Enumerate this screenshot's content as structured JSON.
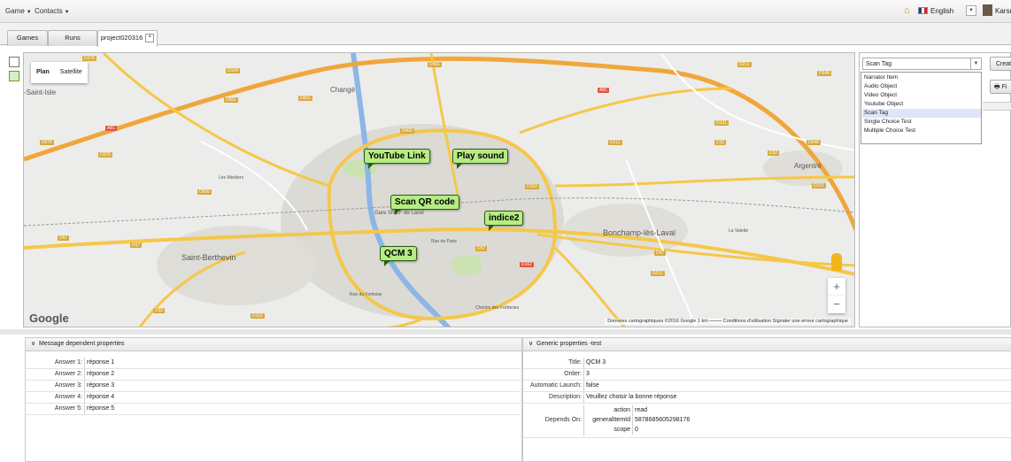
{
  "menubar": {
    "game": "Game",
    "contacts": "Contacts",
    "language": "English",
    "user": "Karsui A"
  },
  "tabs": [
    {
      "label": "Games"
    },
    {
      "label": "Runs"
    },
    {
      "label": "project020316"
    }
  ],
  "map": {
    "type_plan": "Plan",
    "type_satellite": "Satellite",
    "markers": [
      "YouTube Link",
      "Play sound",
      "Scan QR code",
      "indice2",
      "QCM 3"
    ],
    "towns": [
      "Saint-Berthevin",
      "Bonchamp-lès-Laval",
      "Argentré",
      "Changé",
      "Gare SNCF de Laval",
      "-Saint-Isle",
      "Les Mesliers",
      "La Valette",
      "Rue du Fontvise",
      "Rue de Paris",
      "Chemin des Fréheries"
    ],
    "roads": [
      "D278",
      "D104",
      "D561",
      "D561",
      "D561",
      "D900",
      "D57",
      "D57",
      "D57",
      "D162",
      "D211",
      "D211",
      "D211",
      "D131",
      "D32",
      "D32",
      "D548",
      "D131",
      "D900",
      "A81",
      "A81",
      "D576",
      "D576",
      "D113",
      "D32",
      "D57",
      "D162",
      "D546"
    ],
    "google": "Google",
    "attribution": "Données cartographiques ©2016 Google   1 km ⎯⎯⎯⎯⎯    Conditions d'utilisation   Signaler une erreur cartographique",
    "zoom_in": "+",
    "zoom_out": "−"
  },
  "right": {
    "select_value": "Scan Tag",
    "create_label": "Creat",
    "fi_label": "Fi",
    "options": [
      "Narrator Item",
      "Audio Object",
      "Video Object",
      "Youtube Object",
      "Scan Tag",
      "Single Choice Test",
      "Multiple Choice Test"
    ]
  },
  "message_panel": {
    "title": "Message dependent properties",
    "rows": [
      {
        "label": "Answer 1:",
        "value": "réponse 1"
      },
      {
        "label": "Answer 2:",
        "value": "réponse 2"
      },
      {
        "label": "Answer 3:",
        "value": "réponse 3"
      },
      {
        "label": "Answer 4:",
        "value": "réponse 4"
      },
      {
        "label": "Answer 5:",
        "value": "réponse 5"
      }
    ]
  },
  "generic_panel": {
    "title": "Generic properties -test",
    "rows": [
      {
        "label": "Title:",
        "value": "QCM 3"
      },
      {
        "label": "Order:",
        "value": "3"
      },
      {
        "label": "Automatic Launch:",
        "value": "false"
      },
      {
        "label": "Description:",
        "value": "Veuillez choisir la bonne réponse"
      }
    ],
    "depends_label": "Depends On:",
    "depends": [
      {
        "label": "action",
        "value": "read"
      },
      {
        "label": "generalItemId",
        "value": "5878685605298176"
      },
      {
        "label": "scope",
        "value": "0"
      }
    ]
  }
}
